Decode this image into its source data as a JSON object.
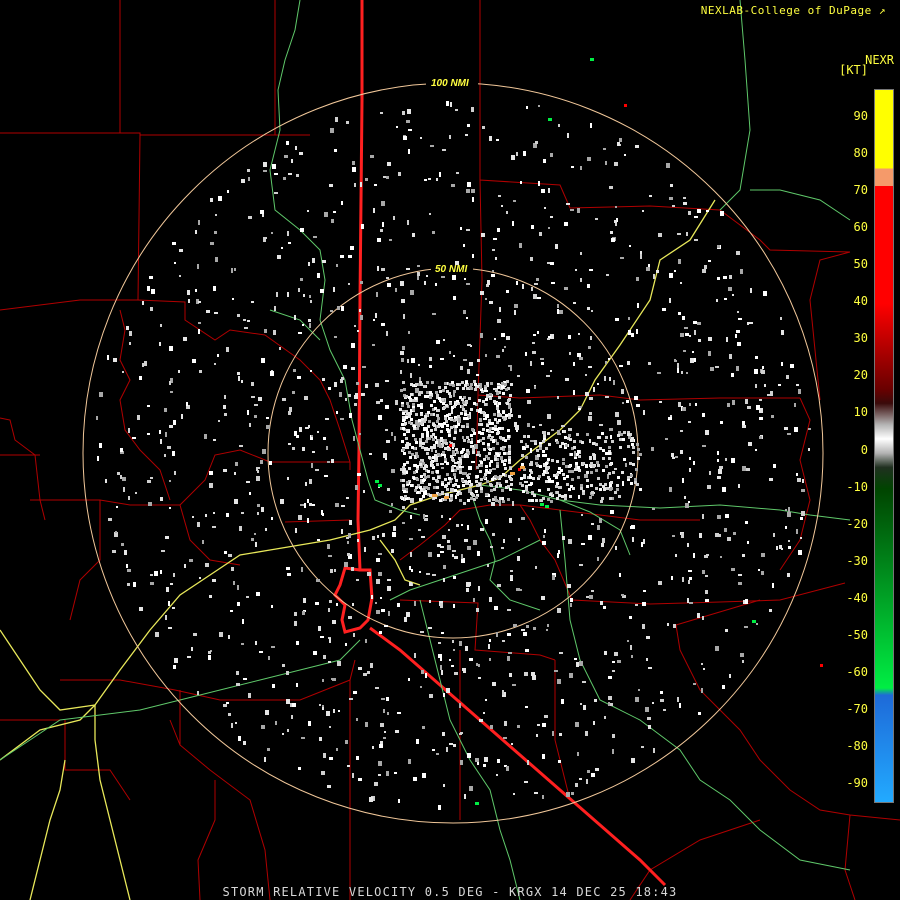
{
  "header": {
    "credit": "NEXLAB-College of DuPage",
    "credit_icon": "external-link-icon",
    "product": "NEXR",
    "units": "[KT]"
  },
  "footer": {
    "caption": "STORM RELATIVE VELOCITY 0.5 DEG - KRGX 14 DEC 25 18:43"
  },
  "range_rings": [
    {
      "label": "100 NMI"
    },
    {
      "label": "50 NMI"
    }
  ],
  "legend": {
    "ticks": [
      "90",
      "80",
      "70",
      "60",
      "50",
      "40",
      "30",
      "20",
      "10",
      "0",
      "-10",
      "-20",
      "-30",
      "-40",
      "-50",
      "-60",
      "-70",
      "-80",
      "-90"
    ],
    "range_kt": [
      -95,
      95
    ],
    "colors": {
      "positive_high": "#ffff00",
      "positive_orange": "#f59a6a",
      "positive_red": "#ff0000",
      "positive_dark_red": "#6a0000",
      "near_zero": "#b4b4b4",
      "negative_dark_green": "#004400",
      "negative_green": "#00ee44",
      "negative_blue": "#1e6ad8",
      "negative_light_blue": "#22aaff"
    }
  },
  "map_colors": {
    "county_lines": "#b00000",
    "state_line": "#ff2020",
    "highways": "#e8e85a",
    "roads": "#5fc86a",
    "range_ring": "#f2c89a"
  }
}
